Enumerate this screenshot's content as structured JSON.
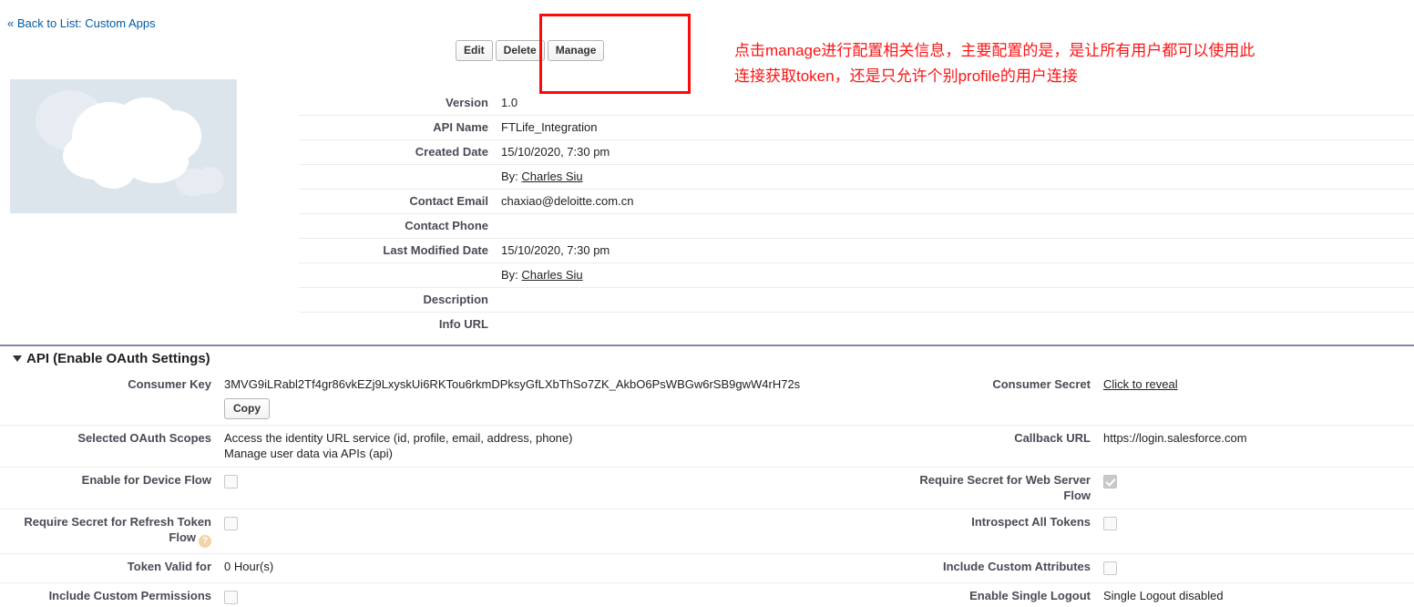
{
  "back_link": "« Back to List: Custom Apps",
  "logo_alt": "cloud-placeholder-logo",
  "toolbar": {
    "edit_label": "Edit",
    "delete_label": "Delete",
    "manage_label": "Manage"
  },
  "annotation": {
    "text": "点击manage进行配置相关信息，主要配置的是，是让所有用户都可以使用此\n连接获取token，还是只允许个别profile的用户连接",
    "color": "#fa1414",
    "highlight_border_color": "#fa0a0a"
  },
  "detail": {
    "rows": [
      {
        "label": "Version",
        "value": "1.0"
      },
      {
        "label": "API Name",
        "value": "FTLife_Integration"
      },
      {
        "label": "Created Date",
        "value": "15/10/2020, 7:30 pm"
      },
      {
        "label": "",
        "value_prefix": "By: ",
        "value_link": "Charles Siu"
      },
      {
        "label": "Contact Email",
        "value": "chaxiao@deloitte.com.cn"
      },
      {
        "label": "Contact Phone",
        "value": ""
      },
      {
        "label": "Last Modified Date",
        "value": "15/10/2020, 7:30 pm"
      },
      {
        "label": "",
        "value_prefix": "By: ",
        "value_link": "Charles Siu"
      },
      {
        "label": "Description",
        "value": ""
      },
      {
        "label": "Info URL",
        "value": ""
      }
    ],
    "created_by_prefix": "By: ",
    "created_by_name": "Charles Siu",
    "modified_by_prefix": "By: ",
    "modified_by_name": "Charles Siu"
  },
  "api_section": {
    "title": "API (Enable OAuth Settings)",
    "consumer_key_label": "Consumer Key",
    "consumer_key_value": "3MVG9iLRabl2Tf4gr86vkEZj9LxyskUi6RKTou6rkmDPksyGfLXbThSo7ZK_AkbO6PsWBGw6rSB9gwW4rH72s",
    "copy_label": "Copy",
    "consumer_secret_label": "Consumer Secret",
    "consumer_secret_value": "Click to reveal",
    "scopes_label": "Selected OAuth Scopes",
    "scope_1": "Access the identity URL service (id, profile, email, address, phone)",
    "scope_2": "Manage user data via APIs (api)",
    "callback_url_label": "Callback URL",
    "callback_url_value": "https://login.salesforce.com",
    "device_flow_label": "Enable for Device Flow",
    "device_flow_checked": false,
    "web_server_flow_label": "Require Secret for Web Server Flow",
    "web_server_flow_checked": true,
    "refresh_token_flow_label": "Require Secret for Refresh Token Flow",
    "refresh_token_flow_checked": false,
    "refresh_token_help_icon": "help-icon",
    "introspect_tokens_label": "Introspect All Tokens",
    "introspect_tokens_checked": false,
    "token_valid_label": "Token Valid for",
    "token_valid_value": "0 Hour(s)",
    "custom_attributes_label": "Include Custom Attributes",
    "custom_attributes_checked": false,
    "custom_permissions_label": "Include Custom Permissions",
    "custom_permissions_checked": false,
    "single_logout_label": "Enable Single Logout",
    "single_logout_value": "Single Logout disabled"
  }
}
